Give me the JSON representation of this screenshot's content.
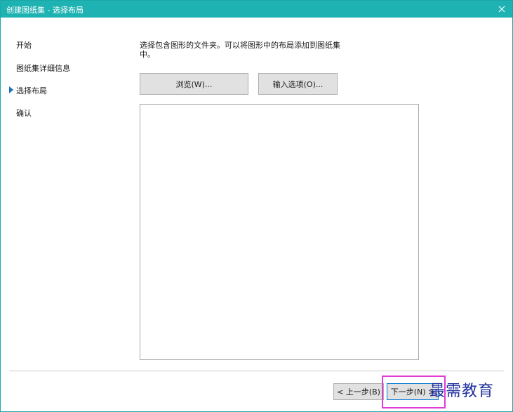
{
  "window": {
    "title": "创建图纸集 - 选择布局",
    "close_glyph": "✕"
  },
  "steps": [
    {
      "label": "开始",
      "active": false
    },
    {
      "label": "图纸集详细信息",
      "active": false
    },
    {
      "label": "选择布局",
      "active": true
    },
    {
      "label": "确认",
      "active": false
    }
  ],
  "content": {
    "description": "选择包含图形的文件夹。可以将图形中的布局添加到图纸集中。",
    "browse_label": "浏览(W)...",
    "import_options_label": "输入选项(O)..."
  },
  "footer": {
    "back_label": "< 上一步(B)",
    "next_label": "下一步(N) >"
  },
  "watermark": "最需教育",
  "colors": {
    "titlebar": "#1fb2b2",
    "active_arrow": "#1b6ec2",
    "highlight": "#e23bd6",
    "watermark": "#1f2f9e"
  }
}
